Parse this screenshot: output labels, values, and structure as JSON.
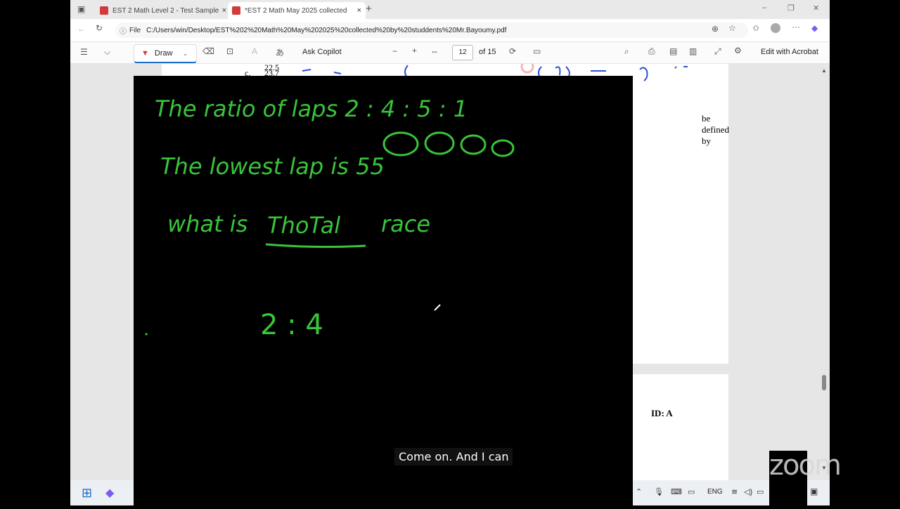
{
  "browser": {
    "tabs": [
      {
        "label": "EST 2 Math Level 2 - Test Sample",
        "close": "×"
      },
      {
        "label": "*EST 2 Math May 2025 collected",
        "close": "×"
      }
    ],
    "new_tab": "+",
    "window_controls": {
      "minimize": "–",
      "maximize": "❐",
      "close": "✕"
    },
    "file_chip": "File",
    "url": "C:/Users/win/Desktop/EST%202%20Math%20May%202025%20collected%20by%20studdents%20Mr.Bayoumy.pdf"
  },
  "pdf_toolbar": {
    "draw_label": "Draw",
    "ask_copilot": "Ask Copilot",
    "page_number": "12",
    "page_total": "of 15",
    "zoom_out": "−",
    "zoom_in": "+",
    "edit_acrobat": "Edit with Acrobat"
  },
  "pdf_content": {
    "row_a_value": "22.5",
    "row_c_label": "c.",
    "row_c_value": "23.7",
    "defined_by": "be defined by",
    "id_label": "ID: A"
  },
  "whiteboard": {
    "line1": "The ratio of laps  2 : 4 : 5 : 1",
    "line2": "The lowest lap is 55",
    "line3_a": "what is",
    "line3_b": "ThoTal",
    "line3_c": "race",
    "line4": "2  :  4"
  },
  "caption": "Come on. And I can",
  "zoom_brand": "zoom",
  "taskbar": {
    "lang": "ENG"
  },
  "colors": {
    "ink": "#39c43a",
    "accent": "#1a6fc9"
  }
}
